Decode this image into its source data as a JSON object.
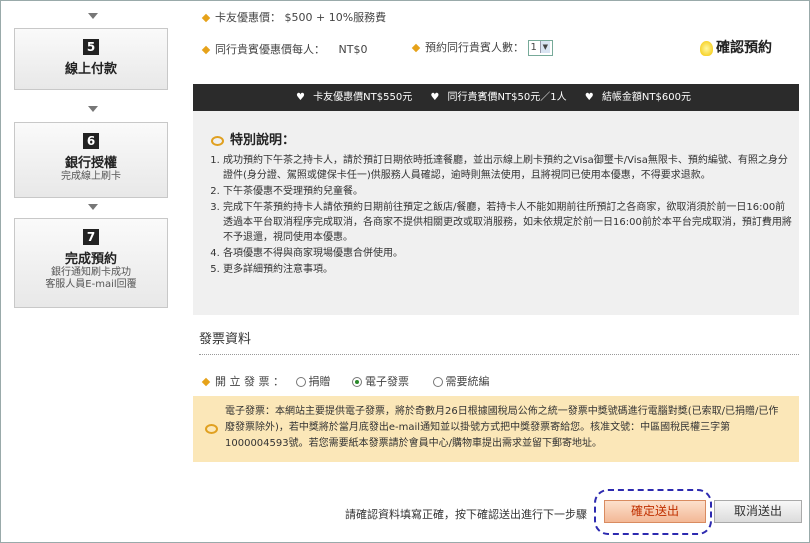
{
  "steps": [
    {
      "num": "5",
      "title": "線上付款",
      "sub1": "",
      "sub2": ""
    },
    {
      "num": "6",
      "title": "銀行授權",
      "sub1": "完成線上刷卡",
      "sub2": ""
    },
    {
      "num": "7",
      "title": "完成預約",
      "sub1": "銀行通知刷卡成功",
      "sub2": "客服人員E-mail回覆"
    }
  ],
  "card_discount": "卡友優惠價： $500 + 10%服務費",
  "companion_price_label": "同行貴賓優惠價每人：",
  "companion_price_value": "NT$0",
  "companion_count_label": "預約同行貴賓人數：",
  "companion_count_value": "1",
  "confirm_label": "確認預約",
  "summary": {
    "card": "卡友優惠價NT$550元",
    "companion": "同行貴賓價NT$50元／1人",
    "total": "結帳金額NT$600元"
  },
  "notes": {
    "title": "特別說明：",
    "items": [
      "成功預約下午茶之持卡人，請於預訂日期依時抵達餐廳，並出示線上刷卡預約之Visa御璽卡/Visa無限卡、預約編號、有照之身分證件(身分證、駕照或健保卡任一)供服務人員確認，逾時則無法使用，且將視同已使用本優惠，不得要求退款。",
      "下午茶優惠不受理預約兒童餐。",
      "完成下午茶預約持卡人請依預約日期前往預定之飯店/餐廳，若持卡人不能如期前往所預訂之各商家，欲取消須於前一日16:00前透過本平台取消程序完成取消，各商家不提供相關更改或取消服務，如未依規定於前一日16:00前於本平台完成取消，預訂費用將不予退還，視同使用本優惠。",
      "各項優惠不得與商家現場優惠合併使用。",
      "更多詳細預約注意事項。"
    ]
  },
  "invoice": {
    "title": "發票資料",
    "issue_label": "開 立 發 票 ：",
    "options": [
      "捐贈",
      "電子發票",
      "需要統編"
    ],
    "selected": "電子發票",
    "info": "電子發票：本網站主要提供電子發票，將於奇數月26日根據國稅局公佈之統一發票中獎號碼進行電腦對獎(已索取/已捐贈/已作廢發票除外)，若中獎將於當月底發出e-mail通知並以掛號方式把中獎發票寄給您。核准文號：中區國稅民權三字第1000004593號。若您需要紙本發票請於會員中心/購物車提出需求並留下郵寄地址。"
  },
  "footer": {
    "prompt": "請確認資料填寫正確，按下確認送出進行下一步驟",
    "submit": "確定送出",
    "cancel": "取消送出"
  }
}
